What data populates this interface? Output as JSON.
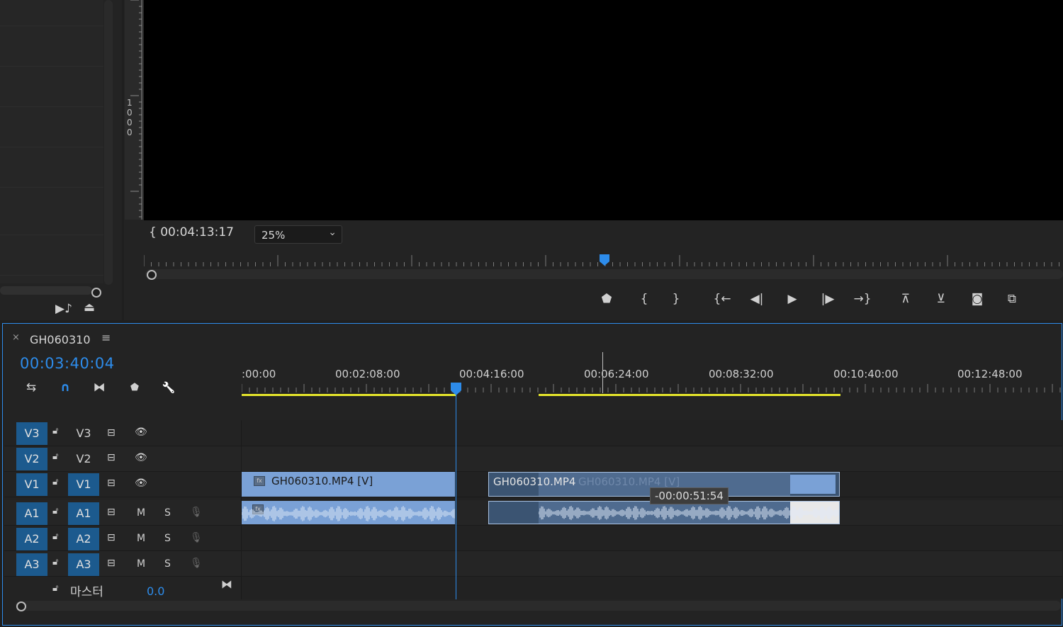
{
  "project_panel": {
    "tools": [
      {
        "name": "automate-to-sequence",
        "glyph": "▶♪"
      },
      {
        "name": "export",
        "glyph": "⏏"
      }
    ]
  },
  "monitor": {
    "ruler_value": "1000",
    "timecode": "00:04:13:17",
    "timecode_prefix": "{",
    "zoom": "25%",
    "transport": [
      {
        "name": "add-marker",
        "glyph": "⬟"
      },
      {
        "name": "mark-in",
        "glyph": "{"
      },
      {
        "name": "mark-out",
        "glyph": "}"
      },
      {
        "name": "go-to-in",
        "glyph": "{←"
      },
      {
        "name": "step-back",
        "glyph": "◀|"
      },
      {
        "name": "play",
        "glyph": "▶"
      },
      {
        "name": "step-forward",
        "glyph": "|▶"
      },
      {
        "name": "go-to-out",
        "glyph": "→}"
      },
      {
        "name": "lift",
        "glyph": "⊼"
      },
      {
        "name": "extract",
        "glyph": "⊻"
      },
      {
        "name": "export-frame",
        "glyph": "◙"
      },
      {
        "name": "compare-view",
        "glyph": "⧉"
      }
    ]
  },
  "timeline": {
    "sequence_name": "GH060310",
    "close_glyph": "×",
    "menu_glyph": "≡",
    "timecode": "00:03:40:04",
    "tools": [
      {
        "name": "nest-toggle",
        "glyph": "⇆"
      },
      {
        "name": "snap",
        "glyph": "∩"
      },
      {
        "name": "linked-selection",
        "glyph": "⧓"
      },
      {
        "name": "add-marker",
        "glyph": "⬟"
      },
      {
        "name": "settings-wrench",
        "glyph": "🔧"
      }
    ],
    "ruler_labels": [
      ":00:00",
      "00:02:08:00",
      "00:04:16:00",
      "00:06:24:00",
      "00:08:32:00",
      "00:10:40:00",
      "00:12:48:00"
    ],
    "tracks": [
      {
        "src": "V3",
        "target": "V3",
        "type": "video"
      },
      {
        "src": "V2",
        "target": "V2",
        "type": "video"
      },
      {
        "src": "V1",
        "target": "V1",
        "type": "video"
      },
      {
        "src": "A1",
        "target": "A1",
        "type": "audio"
      },
      {
        "src": "A2",
        "target": "A2",
        "type": "audio"
      },
      {
        "src": "A3",
        "target": "A3",
        "type": "audio"
      }
    ],
    "mute_label": "M",
    "solo_label": "S",
    "clips": {
      "v1_clip1": "GH060310.MP4 [V]",
      "v1_clip2": "GH060310.MP4",
      "v1_clip2_ghost": "GH060310.MP4 [V]"
    },
    "drag_offset": "-00:00:51:54",
    "master_label": "마스터",
    "master_value": "0.0",
    "colors": {
      "accent": "#2d8ceb",
      "clip": "#7aa1d6",
      "patch": "#1c5a8e",
      "work_area": "#e5e52b"
    }
  }
}
